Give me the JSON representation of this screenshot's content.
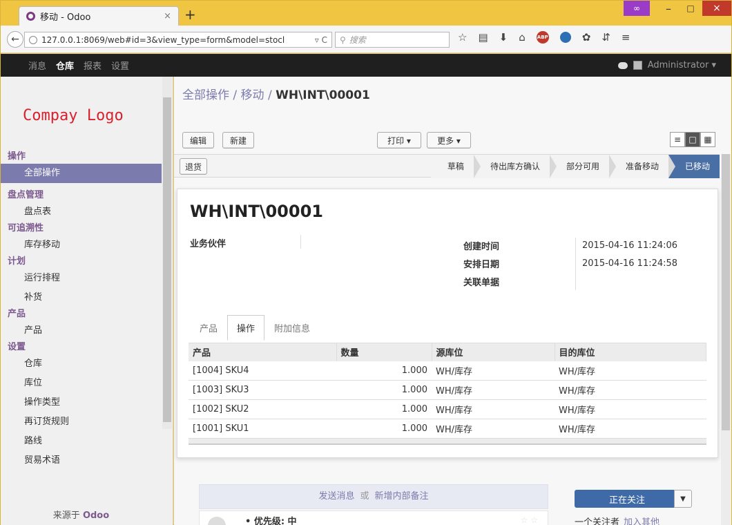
{
  "browser": {
    "tab_title": "移动 - Odoo",
    "tab_close": "×",
    "new_tab": "+",
    "url": "127.0.0.1:8069/web#id=3&view_type=form&model=stocl",
    "url_tail": "▿ C",
    "search_placeholder": "搜索",
    "window_controls": {
      "private_icon": "mask-icon",
      "min": "–",
      "max": "□",
      "close": "×"
    }
  },
  "topbar": {
    "menu": [
      "消息",
      "仓库",
      "报表",
      "设置"
    ],
    "active_menu": "仓库",
    "user": "Administrator ▾"
  },
  "sidebar": {
    "logo": "Compay Logo",
    "sections": [
      {
        "header": "操作",
        "items": [
          "全部操作"
        ]
      },
      {
        "header": "盘点管理",
        "items": [
          "盘点表"
        ]
      },
      {
        "header": "可追溯性",
        "items": [
          "库存移动"
        ]
      },
      {
        "header": "计划",
        "items": [
          "运行排程",
          "补货"
        ]
      },
      {
        "header": "产品",
        "items": [
          "产品"
        ]
      },
      {
        "header": "设置",
        "items": [
          "仓库",
          "库位",
          "操作类型",
          "再订货规则",
          "路线",
          "贸易术语"
        ]
      }
    ],
    "selected_item": "全部操作",
    "footer_prefix": "来源于",
    "footer_brand": "Odoo"
  },
  "main": {
    "breadcrumb": {
      "part1": "全部操作",
      "sep": " / ",
      "part2": "移动",
      "current": "WH\\INT\\00001"
    },
    "buttons": {
      "edit": "编辑",
      "create": "新建",
      "print": "打印 ▾",
      "more": "更多 ▾"
    },
    "return_button": "退货",
    "statuses": [
      "草稿",
      "待出库方确认",
      "部分可用",
      "准备移动",
      "已移动"
    ],
    "current_status": "已移动",
    "record": {
      "reference": "WH\\INT\\00001",
      "partner_label": "业务伙伴",
      "partner_value": "",
      "create_label": "创建时间",
      "create_value": "2015-04-16 11:24:06",
      "scheduled_label": "安排日期",
      "scheduled_value": "2015-04-16 11:24:58",
      "source_doc_label": "关联单据",
      "source_doc_value": ""
    },
    "tabs": [
      "产品",
      "操作",
      "附加信息"
    ],
    "active_tab": "操作",
    "table": {
      "headers": [
        "产品",
        "数量",
        "源库位",
        "目的库位"
      ],
      "rows": [
        [
          "[1004] SKU4",
          "1.000",
          "WH/库存",
          "WH/库存"
        ],
        [
          "[1003] SKU3",
          "1.000",
          "WH/库存",
          "WH/库存"
        ],
        [
          "[1002] SKU2",
          "1.000",
          "WH/库存",
          "WH/库存"
        ],
        [
          "[1001] SKU1",
          "1.000",
          "WH/库存",
          "WH/库存"
        ]
      ]
    },
    "chatter": {
      "send_message": "发送消息",
      "or": "或",
      "log_note": "新增内部备注",
      "following": "正在关注",
      "priority_label": "• 优先级: 中",
      "followers_text": "一个关注者",
      "add_followers": "加入其他"
    }
  }
}
